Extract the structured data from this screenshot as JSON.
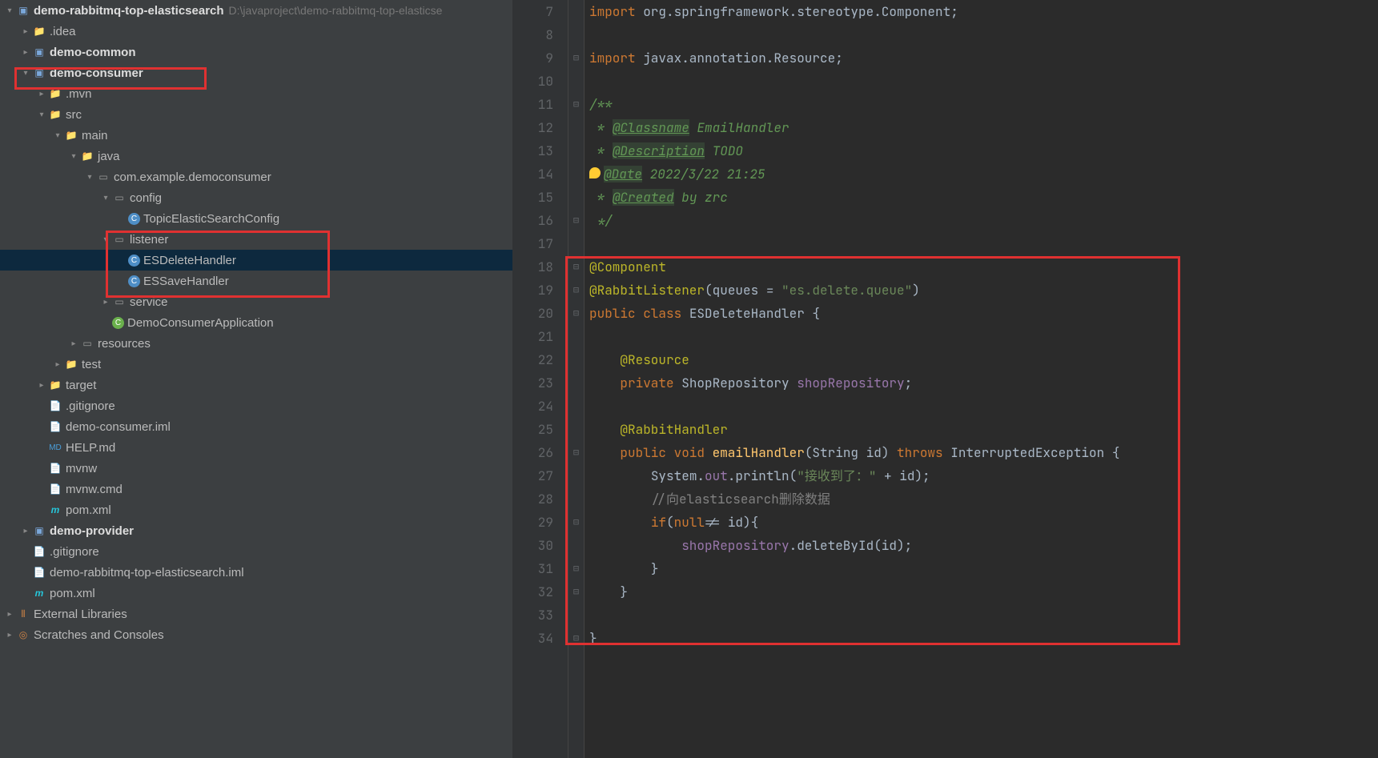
{
  "tree": {
    "root": "demo-rabbitmq-top-elasticsearch",
    "root_path": "D:\\javaproject\\demo-rabbitmq-top-elasticse",
    "idea": ".idea",
    "demo_common": "demo-common",
    "demo_consumer": "demo-consumer",
    "mvn": ".mvn",
    "src": "src",
    "main": "main",
    "java": "java",
    "package": "com.example.democonsumer",
    "config": "config",
    "topic_config": "TopicElasticSearchConfig",
    "listener": "listener",
    "es_delete": "ESDeleteHandler",
    "es_save": "ESSaveHandler",
    "service": "service",
    "app": "DemoConsumerApplication",
    "resources": "resources",
    "test": "test",
    "target": "target",
    "gitignore": ".gitignore",
    "iml": "demo-consumer.iml",
    "help": "HELP.md",
    "mvnw": "mvnw",
    "mvnw_cmd": "mvnw.cmd",
    "pom": "pom.xml",
    "demo_provider": "demo-provider",
    "root_gitignore": ".gitignore",
    "root_iml": "demo-rabbitmq-top-elasticsearch.iml",
    "root_pom": "pom.xml",
    "ext_libs": "External Libraries",
    "scratches": "Scratches and Consoles"
  },
  "gutter": {
    "start": 7,
    "end": 34
  },
  "code": {
    "l7_import": "import ",
    "l7_pkg": "org.springframework.stereotype.Component",
    "l7_end": ";",
    "l9_import": "import ",
    "l9_pkg": "javax.annotation.Resource",
    "l9_end": ";",
    "l11": "/**",
    "l12_star": " * ",
    "l12_tag": "@Classname",
    "l12_txt": " EmailHandler",
    "l13_star": " * ",
    "l13_tag": "@Description",
    "l13_txt": " TODO",
    "l14_star": " * ",
    "l14_tag": "@Date",
    "l14_txt": " 2022/3/22 21:25",
    "l15_star": " * ",
    "l15_tag": "@Created",
    "l15_txt": " by zrc",
    "l16": " */",
    "l18": "@Component",
    "l19_ann": "@RabbitListener",
    "l19_p1": "(queues = ",
    "l19_str": "\"es.delete.queue\"",
    "l19_p2": ")",
    "l20_kw1": "public class ",
    "l20_cls": "ESDeleteHandler",
    "l20_brace": " {",
    "l22": "@Resource",
    "l23_kw": "private ",
    "l23_type": "ShopRepository ",
    "l23_field": "shopRepository",
    "l23_end": ";",
    "l25": "@RabbitHandler",
    "l26_kw1": "public void ",
    "l26_method": "emailHandler",
    "l26_p1": "(String id) ",
    "l26_kw2": "throws ",
    "l26_exc": "InterruptedException {",
    "l27_sys": "System.",
    "l27_out": "out",
    "l27_println": ".println(",
    "l27_str": "\"接收到了：\"",
    "l27_plus": " + id);",
    "l28": "//向elasticsearch删除数据",
    "l29_if": "if",
    "l29_cond": "(",
    "l29_null": "null",
    "l29_rest": "!= id){",
    "l30_field": "shopRepository",
    "l30_call": ".deleteById(id);",
    "l31": "}",
    "l32": "}",
    "l34": "}"
  }
}
